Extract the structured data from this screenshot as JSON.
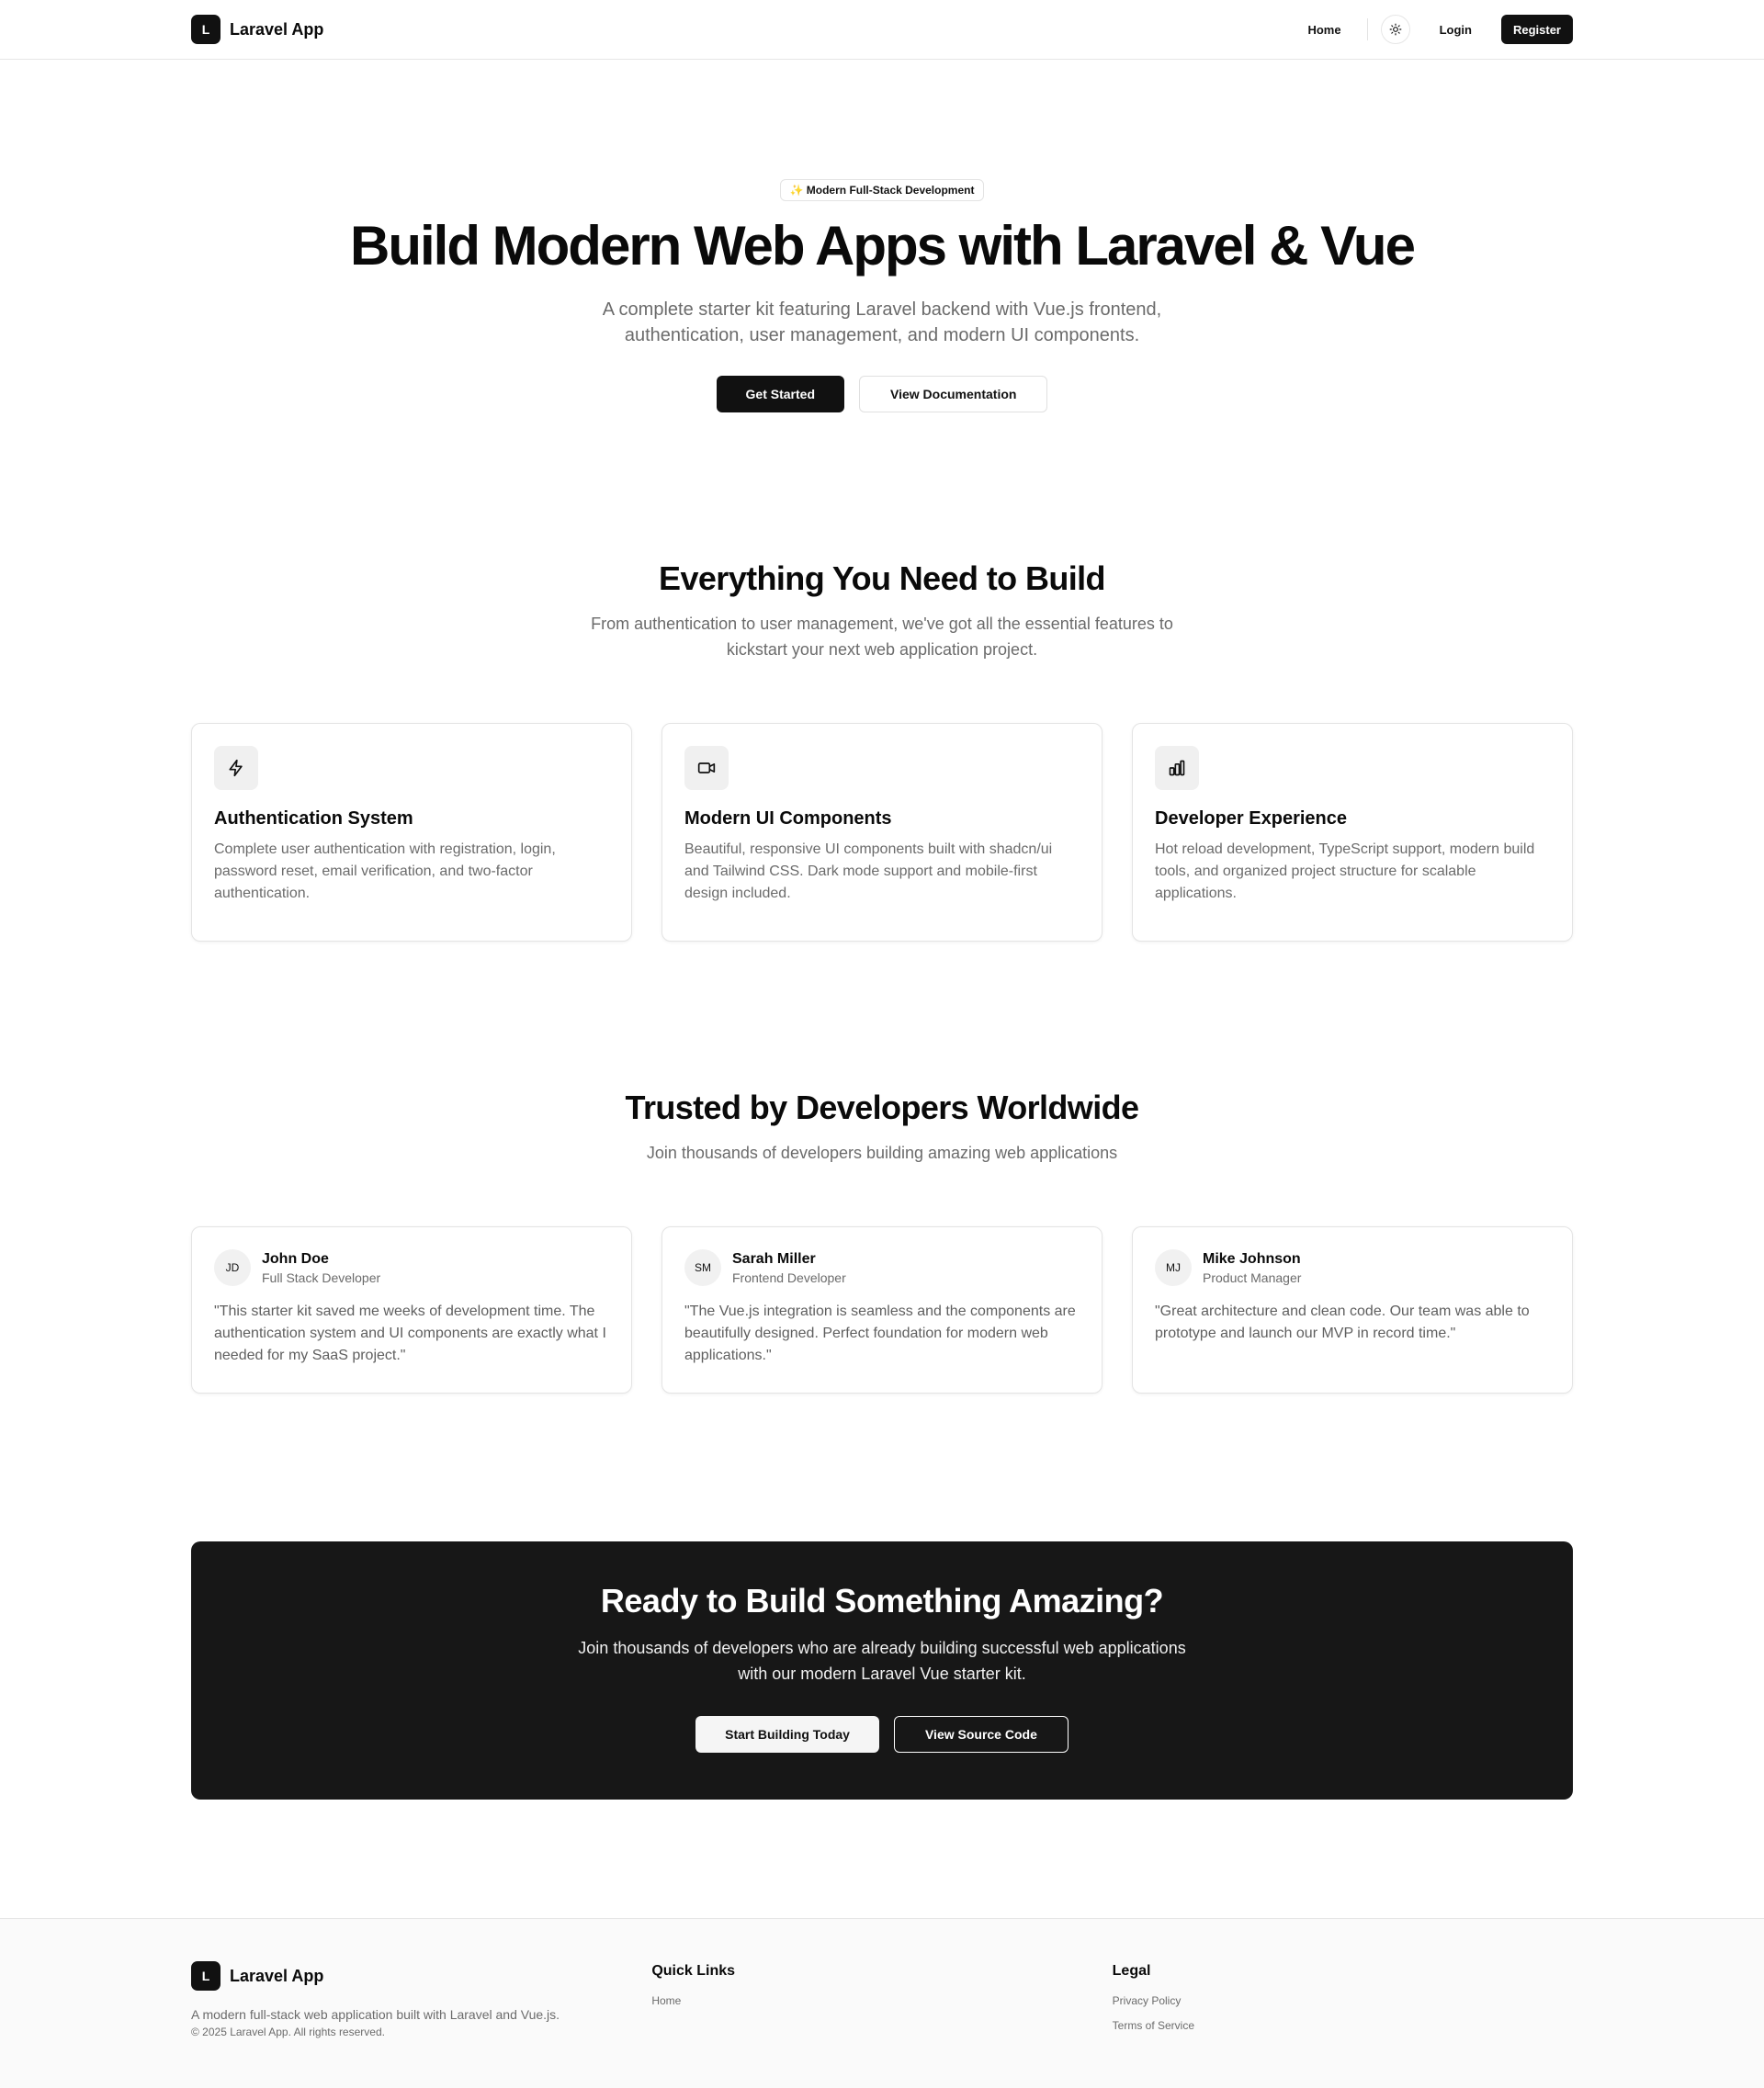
{
  "header": {
    "brand_mark": "L",
    "brand_name": "Laravel App",
    "nav": {
      "home": "Home",
      "login": "Login",
      "register": "Register"
    },
    "theme_icon": "sun-icon"
  },
  "hero": {
    "badge": "✨ Modern Full-Stack Development",
    "title": "Build Modern Web Apps with Laravel & Vue",
    "subtitle": "A complete starter kit featuring Laravel backend with Vue.js frontend, authentication, user management, and modern UI components.",
    "primary_cta": "Get Started",
    "secondary_cta": "View Documentation"
  },
  "features": {
    "title": "Everything You Need to Build",
    "subtitle": "From authentication to user management, we've got all the essential features to kickstart your next web application project.",
    "items": [
      {
        "icon": "lightning-icon",
        "title": "Authentication System",
        "text": "Complete user authentication with registration, login, password reset, email verification, and two-factor authentication."
      },
      {
        "icon": "video-icon",
        "title": "Modern UI Components",
        "text": "Beautiful, responsive UI components built with shadcn/ui and Tailwind CSS. Dark mode support and mobile-first design included."
      },
      {
        "icon": "bar-chart-icon",
        "title": "Developer Experience",
        "text": "Hot reload development, TypeScript support, modern build tools, and organized project structure for scalable applications."
      }
    ]
  },
  "testimonials": {
    "title": "Trusted by Developers Worldwide",
    "subtitle": "Join thousands of developers building amazing web applications",
    "items": [
      {
        "initials": "JD",
        "name": "John Doe",
        "role": "Full Stack Developer",
        "quote": "\"This starter kit saved me weeks of development time. The authentication system and UI components are exactly what I needed for my SaaS project.\""
      },
      {
        "initials": "SM",
        "name": "Sarah Miller",
        "role": "Frontend Developer",
        "quote": "\"The Vue.js integration is seamless and the components are beautifully designed. Perfect foundation for modern web applications.\""
      },
      {
        "initials": "MJ",
        "name": "Mike Johnson",
        "role": "Product Manager",
        "quote": "\"Great architecture and clean code. Our team was able to prototype and launch our MVP in record time.\""
      }
    ]
  },
  "cta": {
    "title": "Ready to Build Something Amazing?",
    "subtitle": "Join thousands of developers who are already building successful web applications with our modern Laravel Vue starter kit.",
    "primary": "Start Building Today",
    "secondary": "View Source Code"
  },
  "footer": {
    "brand_mark": "L",
    "brand_name": "Laravel App",
    "description": "A modern full-stack web application built with Laravel and Vue.js.",
    "copyright": "© 2025 Laravel App. All rights reserved.",
    "quick_links_heading": "Quick Links",
    "quick_links": [
      "Home"
    ],
    "legal_heading": "Legal",
    "legal_links": [
      "Privacy Policy",
      "Terms of Service"
    ]
  },
  "colors": {
    "primary": "#111111",
    "muted_text": "#6b6b6b",
    "border": "#e4e4e4",
    "cta_bg": "#171717",
    "footer_bg": "#fafafa"
  }
}
